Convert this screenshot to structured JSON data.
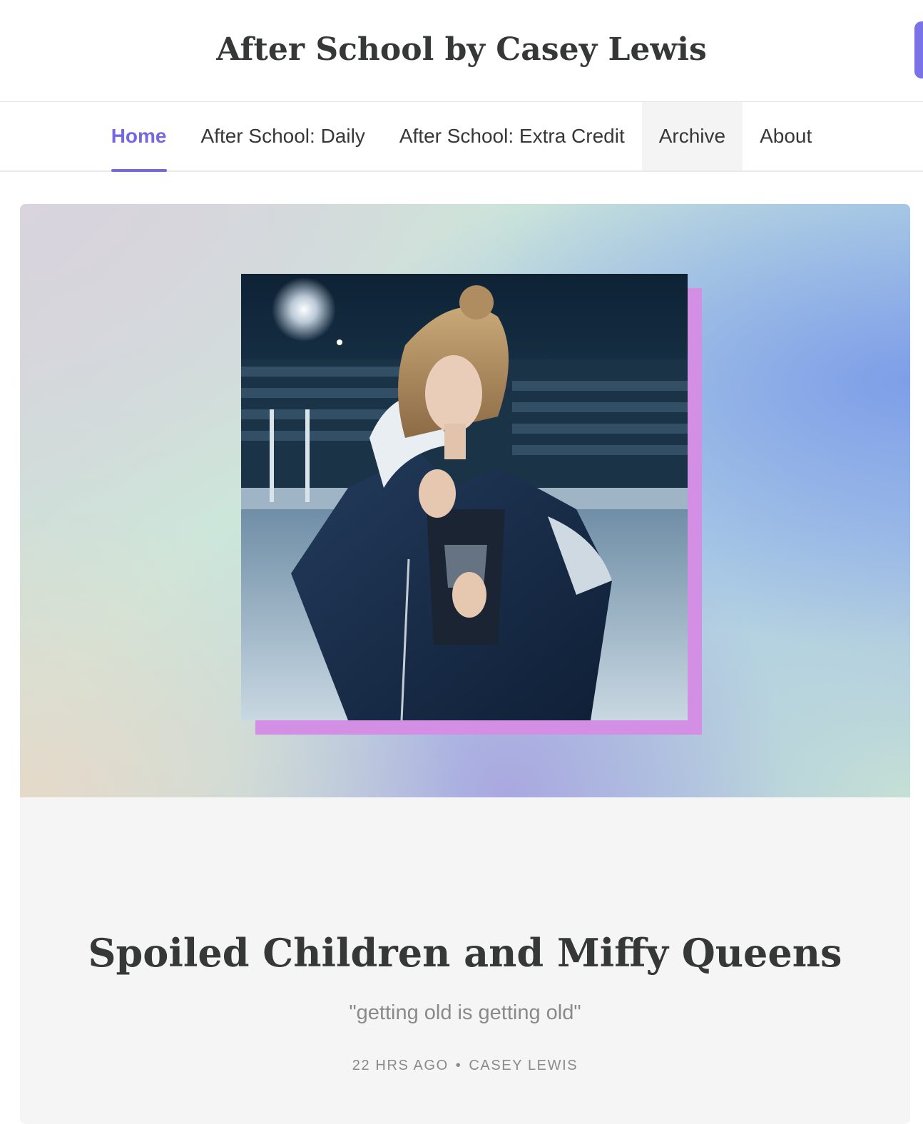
{
  "header": {
    "site_title": "After School by Casey Lewis"
  },
  "nav": {
    "tabs": [
      {
        "label": "Home",
        "active": true
      },
      {
        "label": "After School: Daily",
        "active": false
      },
      {
        "label": "After School: Extra Credit",
        "active": false
      },
      {
        "label": "Archive",
        "active": false
      },
      {
        "label": "About",
        "active": false
      }
    ]
  },
  "post": {
    "title": "Spoiled Children and Miffy Queens",
    "subtitle": "\"getting old is getting old\"",
    "time_ago": "22 HRS AGO",
    "separator": "•",
    "author": "CASEY LEWIS"
  },
  "colors": {
    "accent": "#7567e3",
    "text": "#363737",
    "muted": "#8a8a8a",
    "photo_frame": "#d38fe3"
  }
}
